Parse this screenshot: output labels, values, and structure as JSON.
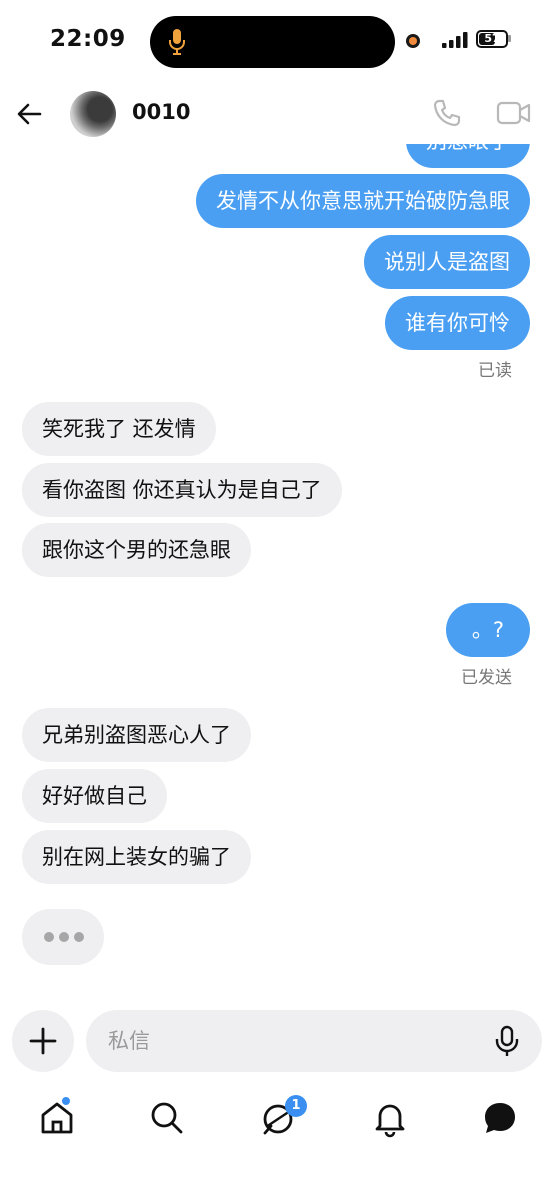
{
  "status_bar": {
    "time": "22:09",
    "battery": "57"
  },
  "header": {
    "contact_name": "0010"
  },
  "messages": [
    {
      "side": "out",
      "text": "别惹眼了"
    },
    {
      "side": "out",
      "text": "发情不从你意思就开始破防急眼"
    },
    {
      "side": "out",
      "text": "说别人是盗图"
    },
    {
      "side": "out",
      "text": "谁有你可怜"
    },
    {
      "receipt": "已读"
    },
    {
      "side": "in",
      "text": "笑死我了  还发情"
    },
    {
      "side": "in",
      "text": "看你盗图 你还真认为是自己了"
    },
    {
      "side": "in",
      "text": "跟你这个男的还急眼"
    },
    {
      "side": "out",
      "text": "。?"
    },
    {
      "receipt": "已发送"
    },
    {
      "side": "in",
      "text": "兄弟别盗图恶心人了"
    },
    {
      "side": "in",
      "text": "好好做自己"
    },
    {
      "side": "in",
      "text": "别在网上装女的骗了"
    }
  ],
  "composer": {
    "placeholder": "私信"
  },
  "nav": {
    "items": [
      "home-icon",
      "search-icon",
      "chat-icon",
      "bell-icon",
      "messages-icon"
    ],
    "chat_badge": "1"
  },
  "colors": {
    "outgoing": "#4a9ff2",
    "incoming": "#efeff1",
    "accent": "#3b8ff0"
  }
}
